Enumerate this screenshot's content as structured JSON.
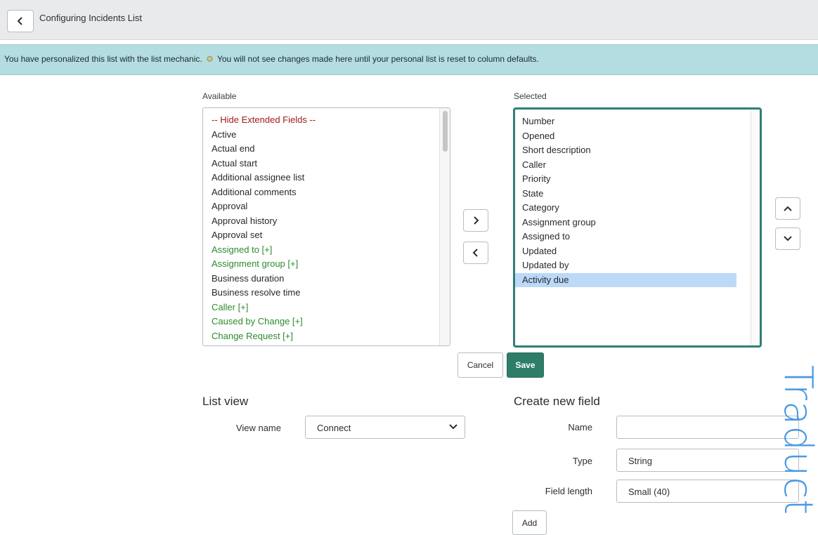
{
  "header": {
    "title": "Configuring Incidents List",
    "back_icon": "chevron-left-icon"
  },
  "banner": {
    "text_before": "You have personalized this list with the list mechanic.",
    "icon": "gear-icon",
    "text_after": "You will not see changes made here until your personal list is reset to column defaults."
  },
  "available": {
    "label": "Available",
    "items": [
      {
        "label": "-- Hide Extended Fields --",
        "kind": "extended"
      },
      {
        "label": "Active",
        "kind": "normal"
      },
      {
        "label": "Actual end",
        "kind": "normal"
      },
      {
        "label": "Actual start",
        "kind": "normal"
      },
      {
        "label": "Additional assignee list",
        "kind": "normal"
      },
      {
        "label": "Additional comments",
        "kind": "normal"
      },
      {
        "label": "Approval",
        "kind": "normal"
      },
      {
        "label": "Approval history",
        "kind": "normal"
      },
      {
        "label": "Approval set",
        "kind": "normal"
      },
      {
        "label": "Assigned to [+]",
        "kind": "reference"
      },
      {
        "label": "Assignment group [+]",
        "kind": "reference"
      },
      {
        "label": "Business duration",
        "kind": "normal"
      },
      {
        "label": "Business resolve time",
        "kind": "normal"
      },
      {
        "label": "Caller [+]",
        "kind": "reference"
      },
      {
        "label": "Caused by Change [+]",
        "kind": "reference"
      },
      {
        "label": "Change Request [+]",
        "kind": "reference"
      }
    ]
  },
  "selected": {
    "label": "Selected",
    "items": [
      "Number",
      "Opened",
      "Short description",
      "Caller",
      "Priority",
      "State",
      "Category",
      "Assignment group",
      "Assigned to",
      "Updated",
      "Updated by",
      "Activity due"
    ],
    "highlighted": "Activity due"
  },
  "actions": {
    "cancel_label": "Cancel",
    "save_label": "Save"
  },
  "list_view": {
    "title": "List view",
    "view_name_label": "View name",
    "view_name_value": "Connect"
  },
  "create_field": {
    "title": "Create new field",
    "name_label": "Name",
    "name_value": "",
    "type_label": "Type",
    "type_value": "String",
    "length_label": "Field length",
    "length_value": "Small (40)",
    "add_label": "Add"
  },
  "watermark": "Traduct",
  "colors": {
    "banner": "#b4dde2",
    "save": "#2e7d69",
    "extended": "#a01c1c",
    "reference": "#2e8a2e",
    "highlight": "#bcd9f8",
    "watermark": "#4a9ae0"
  }
}
